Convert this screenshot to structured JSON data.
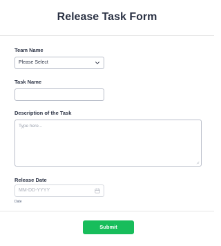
{
  "form": {
    "title": "Release Task Form"
  },
  "fields": {
    "team_name": {
      "label": "Team Name",
      "selected_value": "Please Select"
    },
    "task_name": {
      "label": "Task Name",
      "value": ""
    },
    "description": {
      "label": "Description of the Task",
      "placeholder": "Type here..."
    },
    "release_date": {
      "label": "Release Date",
      "placeholder": "MM-DD-YYYY",
      "sublabel": "Date"
    }
  },
  "actions": {
    "submit_label": "Submit"
  },
  "colors": {
    "submit_bg": "#18bd5b",
    "title_text": "#2c3345",
    "input_border": "#b8bdc9"
  },
  "icons": [
    "chevron-down-icon",
    "calendar-icon",
    "resize-handle-icon"
  ]
}
